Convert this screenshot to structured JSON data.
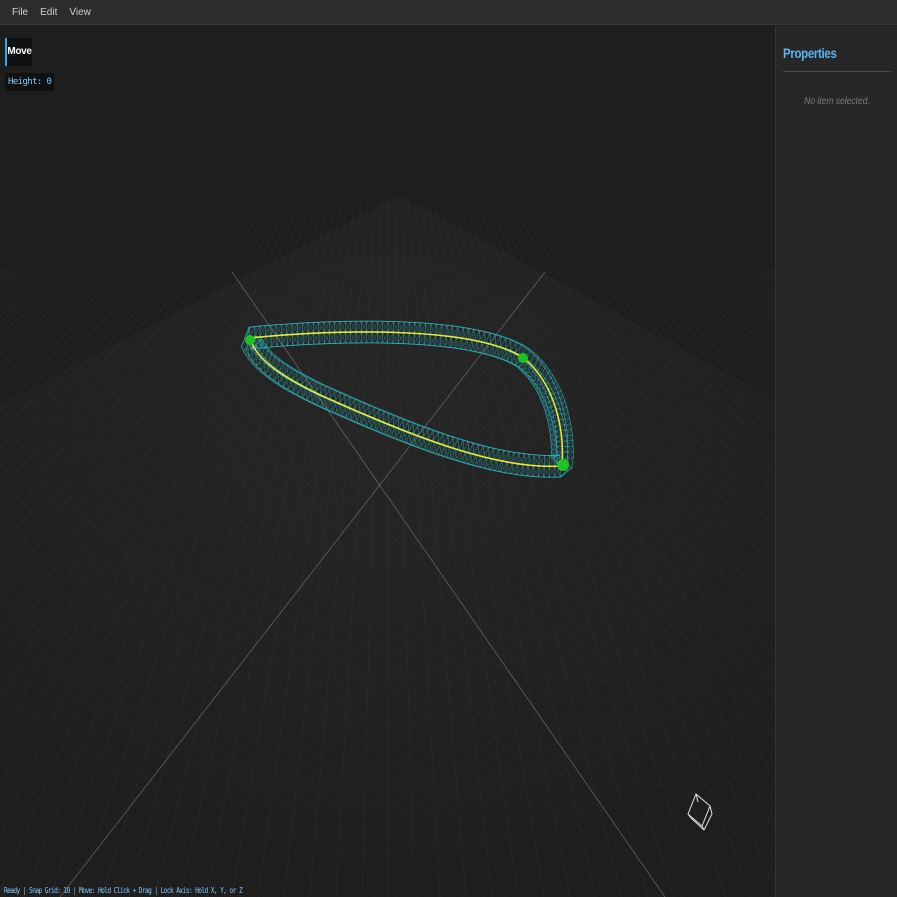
{
  "menubar": {
    "items": [
      {
        "label": "File"
      },
      {
        "label": "Edit"
      },
      {
        "label": "View"
      }
    ]
  },
  "toolbar": {
    "move_label": "Move",
    "height_readout": "Height: 0"
  },
  "statusbar": {
    "text": "Ready | Snap Grid: 10 | Move: Hold Click + Drag | Lock Axis: Hold X, Y, or Z"
  },
  "properties": {
    "title": "Properties",
    "empty_message": "No item selected."
  },
  "scene": {
    "tube_color": "#2fb8c0",
    "path_color": "#e8e830",
    "control_point_color": "#1fc21f",
    "grid_color": "#3a3a3a",
    "axis_color": "#6a6a6a",
    "control_points": 3
  },
  "colors": {
    "accent": "#3aa0e0",
    "panel_title": "#5ab4f0",
    "status_text": "#7ec8ff"
  }
}
